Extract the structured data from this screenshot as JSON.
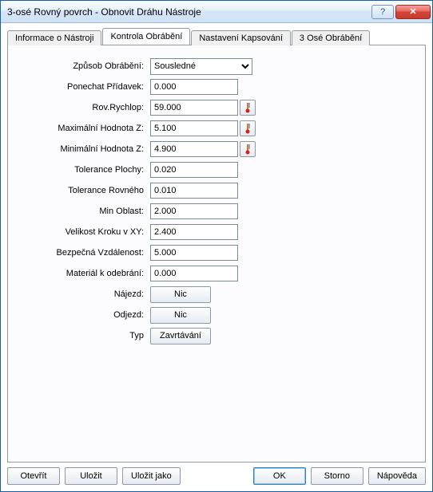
{
  "window": {
    "title": "3-osé Rovný povrch - Obnovit Dráhu Nástroje",
    "help_symbol": "?",
    "close_symbol": "✕"
  },
  "tabs": [
    {
      "label": "Informace o Nástroji",
      "active": false
    },
    {
      "label": "Kontrola Obrábění",
      "active": true
    },
    {
      "label": "Nastavení Kapsování",
      "active": false
    },
    {
      "label": "3 Osé Obrábění",
      "active": false
    }
  ],
  "form": {
    "zpusob_label": "Způsob Obrábění:",
    "zpusob_value": "Sousledné",
    "zpusob_options": [
      "Sousledné"
    ],
    "pridavek_label": "Ponechat Přídavek:",
    "pridavek_value": "0.000",
    "rychlop_label": "Rov.Rychlop:",
    "rychlop_value": "59.000",
    "maxz_label": "Maximální Hodnota Z:",
    "maxz_value": "5.100",
    "minz_label": "Minimální Hodnota Z:",
    "minz_value": "4.900",
    "tolplochy_label": "Tolerance Plochy:",
    "tolplochy_value": "0.020",
    "tolrov_label": "Tolerance Rovného",
    "tolrov_value": "0.010",
    "minoblast_label": "Min Oblast:",
    "minoblast_value": "2.000",
    "krokxy_label": "Velikost Kroku v XY:",
    "krokxy_value": "2.400",
    "bezpecna_label": "Bezpečná Vzdálenost:",
    "bezpecna_value": "5.000",
    "material_label": "Materiál k odebrání:",
    "material_value": "0.000",
    "najezd_label": "Nájezd:",
    "najezd_btn": "Nic",
    "odjezd_label": "Odjezd:",
    "odjezd_btn": "Nic",
    "typ_label": "Typ",
    "typ_btn": "Zavrtávání"
  },
  "buttons": {
    "open": "Otevřít",
    "save": "Uložit",
    "save_as": "Uložit jako",
    "ok": "OK",
    "cancel": "Storno",
    "help": "Nápověda"
  }
}
